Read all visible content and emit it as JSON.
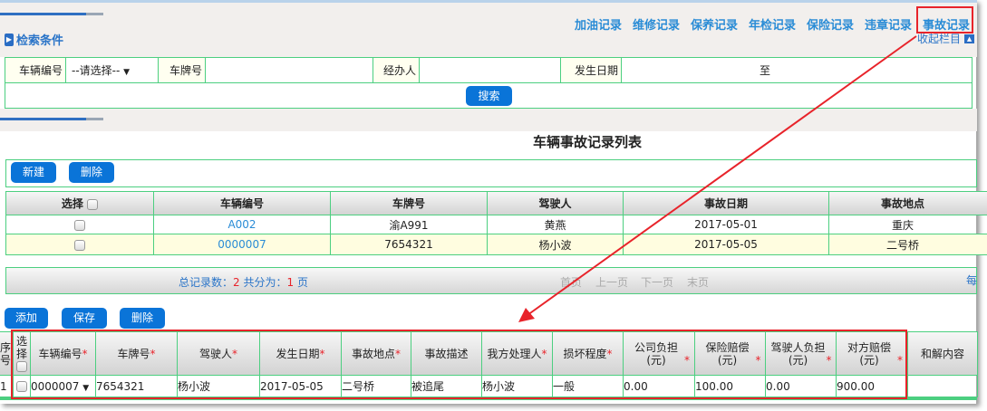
{
  "nav": {
    "links": [
      "加油记录",
      "维修记录",
      "保养记录",
      "年检记录",
      "保险记录",
      "违章记录",
      "事故记录"
    ],
    "active": "事故记录"
  },
  "search": {
    "section_title": "检索条件",
    "collapse_label": "收起栏目",
    "vehicle_no_label": "车辆编号",
    "vehicle_no_value": "--请选择--",
    "plate_label": "车牌号",
    "plate_value": "",
    "handler_label": "经办人",
    "handler_value": "",
    "date_label": "发生日期",
    "date_sep": "至",
    "search_button": "搜索"
  },
  "list": {
    "title": "车辆事故记录列表",
    "new_button": "新建",
    "delete_button": "删除",
    "columns": [
      "选择",
      "车辆编号",
      "车牌号",
      "驾驶人",
      "事故日期",
      "事故地点"
    ],
    "rows": [
      {
        "vehicle_no": "A002",
        "plate": "渝A991",
        "driver": "黄燕",
        "date": "2017-05-01",
        "location": "重庆"
      },
      {
        "vehicle_no": "0000007",
        "plate": "7654321",
        "driver": "杨小波",
        "date": "2017-05-05",
        "location": "二号桥"
      }
    ]
  },
  "pagination": {
    "total_label": "总记录数：",
    "total": "2",
    "pages_label": "共分为：",
    "pages": "1",
    "pages_unit": "页",
    "first": "首页",
    "prev": "上一页",
    "next": "下一页",
    "last": "末页",
    "per_page": "每"
  },
  "editor": {
    "add_button": "添加",
    "save_button": "保存",
    "delete_button": "删除",
    "columns": [
      {
        "label": "序号",
        "req": false
      },
      {
        "label": "选择",
        "req": false
      },
      {
        "label": "车辆编号",
        "req": true
      },
      {
        "label": "车牌号",
        "req": true
      },
      {
        "label": "驾驶人",
        "req": true
      },
      {
        "label": "发生日期",
        "req": true
      },
      {
        "label": "事故地点",
        "req": true
      },
      {
        "label": "事故描述",
        "req": false
      },
      {
        "label": "我方处理人",
        "req": true
      },
      {
        "label": "损坏程度",
        "req": true
      },
      {
        "label": "公司负担(元)",
        "req": true
      },
      {
        "label": "保险赔偿(元)",
        "req": true
      },
      {
        "label": "驾驶人负担(元)",
        "req": true
      },
      {
        "label": "对方赔偿(元)",
        "req": true
      },
      {
        "label": "和解内容",
        "req": false
      }
    ],
    "row": {
      "index": "1",
      "vehicle_no": "0000007",
      "plate": "7654321",
      "driver": "杨小波",
      "date": "2017-05-05",
      "location": "二号桥",
      "description": "被追尾",
      "handler": "杨小波",
      "damage": "一般",
      "company": "0.00",
      "insurance": "100.00",
      "driver_cost": "0.00",
      "other_party": "900.00",
      "settlement": ""
    }
  },
  "colors": {
    "accent": "#0a74d8",
    "border": "#4ccf80",
    "highlight": "#e8232a"
  }
}
